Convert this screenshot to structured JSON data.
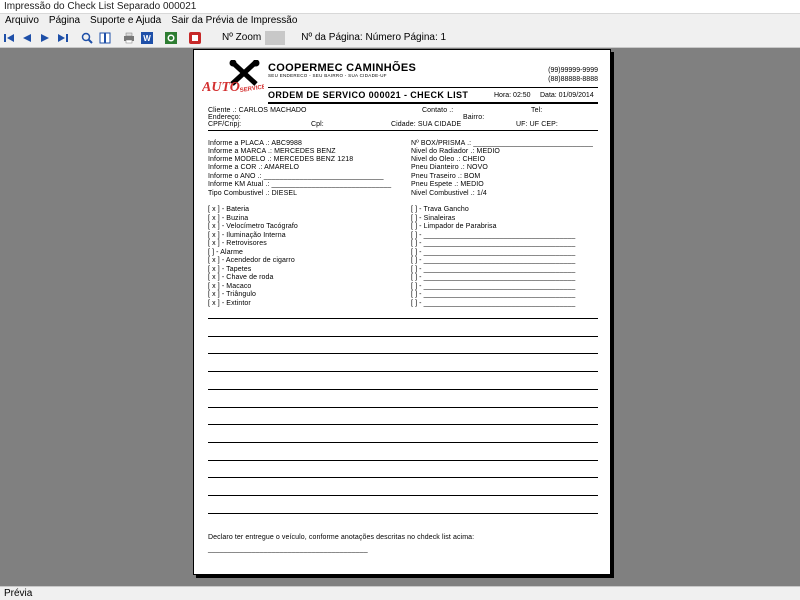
{
  "window": {
    "title": "Impressão do Check List Separado 000021"
  },
  "menu": [
    "Arquivo",
    "Página",
    "Suporte e Ajuda",
    "Sair da Prévia de Impressão"
  ],
  "toolbar": {
    "zoom_label": "Nº Zoom",
    "page_label": "Nº da Página: Número Página: 1"
  },
  "status": "Prévia",
  "report": {
    "logo": {
      "word1": "AUTO",
      "word2": "SERVICE"
    },
    "company": "COOPERMEC CAMINHÕES",
    "address": "SEU ENDERECO - SEU BAIRRO - SUA CIDADE-UF",
    "phones": [
      "(99)99999-9999",
      "(88)88888-8888"
    ],
    "os_title": "ORDEM DE SERVICO 000021  -  CHECK LIST",
    "hora": "Hora: 02:50",
    "data": "Data: 01/09/2014",
    "client": {
      "cliente": "Cliente  .:  CARLOS MACHADO",
      "contato": "Contato .:",
      "tel": "Tel:",
      "endereco": "Endereço:",
      "bairro": "Bairro:",
      "cpf": "CPF/Cnpj:",
      "cpl": "Cpl:",
      "cidade": "Cidade: SUA CIDADE",
      "uf": "UF: UF  CEP:"
    },
    "vehicle_left": [
      "Informe a PLACA  .: ABC9988",
      "Informe a MARCA  .: MERCEDES BENZ",
      "Informe MODELO  .: MERCEDES BENZ 1218",
      "Informe a COR      .: AMARELO",
      "Informe o ANO       .: ______________________________",
      "Informe KM Atual   .: ______________________________",
      "Tipo Combustivel  .: DIESEL"
    ],
    "vehicle_right": [
      "Nº BOX/PRISMA  .: ______________________________",
      "Nivel do Radiador  .: MEDIO",
      "Nivel do Oleo       .: CHEIO",
      "Pneu Dianteiro     .: NOVO",
      "Pneu Traseiro      .: BOM",
      "Pneu Espete        .: MEDIO",
      "Nivel Combustivel  .: 1/4"
    ],
    "checks_left": [
      "[ x ] - Bateria",
      "[ x ] - Buzina",
      "[ x ] - Velocímetro Tacógrafo",
      "[ x ] - Iluminação Interna",
      "[ x ] - Retrovisores",
      "[   ] - Alarme",
      "[ x ] - Acendedor de cigarro",
      "[ x ] - Tapetes",
      "[ x ] - Chave de roda",
      "[ x ] - Macaco",
      "[ x ] - Triângulo",
      "[ x ] - Extintor"
    ],
    "checks_right": [
      "[   ] - Trava Gancho",
      "[   ] - Sinaleiras",
      "[   ] - Limpador de Parabrisa",
      "[   ] - ______________________________________",
      "[   ] - ______________________________________",
      "[   ] - ______________________________________",
      "[   ] - ______________________________________",
      "[   ] - ______________________________________",
      "[   ] - ______________________________________",
      "[   ] - ______________________________________",
      "[   ] - ______________________________________",
      "[   ] - ______________________________________"
    ],
    "declaration": "Declaro ter entregue o veículo, conforme anotações descritas no chdeck list acima:",
    "signature": "________________________________________"
  }
}
